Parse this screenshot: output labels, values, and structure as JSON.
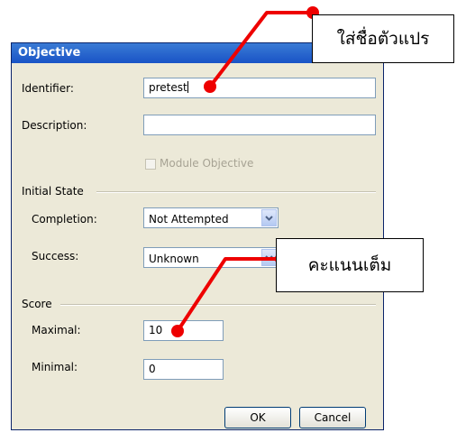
{
  "dialog": {
    "title": "Objective",
    "identifier_label": "Identifier:",
    "identifier_value": "pretest",
    "description_label": "Description:",
    "description_value": "",
    "module_objective_label": "Module Objective",
    "initial_state_label": "Initial State",
    "completion_label": "Completion:",
    "completion_value": "Not Attempted",
    "success_label": "Success:",
    "success_value": "Unknown",
    "score_label": "Score",
    "maximal_label": "Maximal:",
    "maximal_value": "10",
    "minimal_label": "Minimal:",
    "minimal_value": "0",
    "ok_label": "OK",
    "cancel_label": "Cancel"
  },
  "annotations": {
    "callout_identifier": "ใส่ชื่อตัวแปร",
    "callout_score": "คะแนนเต็ม",
    "arrow_color": "#ee0000"
  }
}
